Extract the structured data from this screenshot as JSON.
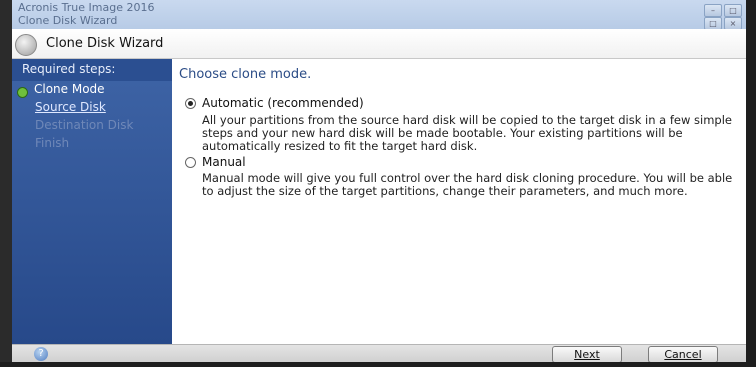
{
  "window": {
    "app_title": "Acronis True Image 2016",
    "title": "Clone Disk Wizard",
    "controls": [
      "–",
      "□",
      "×"
    ]
  },
  "header": {
    "title": "Clone Disk Wizard"
  },
  "sidebar": {
    "heading": "Required steps:",
    "steps": [
      {
        "label": "Clone Mode",
        "state": "current"
      },
      {
        "label": "Source Disk",
        "state": "link"
      },
      {
        "label": "Destination Disk",
        "state": "disabled"
      },
      {
        "label": "Finish",
        "state": "disabled"
      }
    ]
  },
  "content": {
    "title": "Choose clone mode.",
    "options": [
      {
        "label": "Automatic (recommended)",
        "selected": true,
        "description": "All your partitions from the source hard disk will be copied to the target disk in a few simple steps and your new hard disk will be made bootable. Your existing partitions will be automatically resized to fit the target hard disk."
      },
      {
        "label": "Manual",
        "selected": false,
        "description": "Manual mode will give you full control over the hard disk cloning procedure. You will be able to adjust the size of the target partitions, change their parameters, and much more."
      }
    ]
  },
  "footer": {
    "help_glyph": "?",
    "next_label": "Next",
    "cancel_label": "Cancel"
  }
}
